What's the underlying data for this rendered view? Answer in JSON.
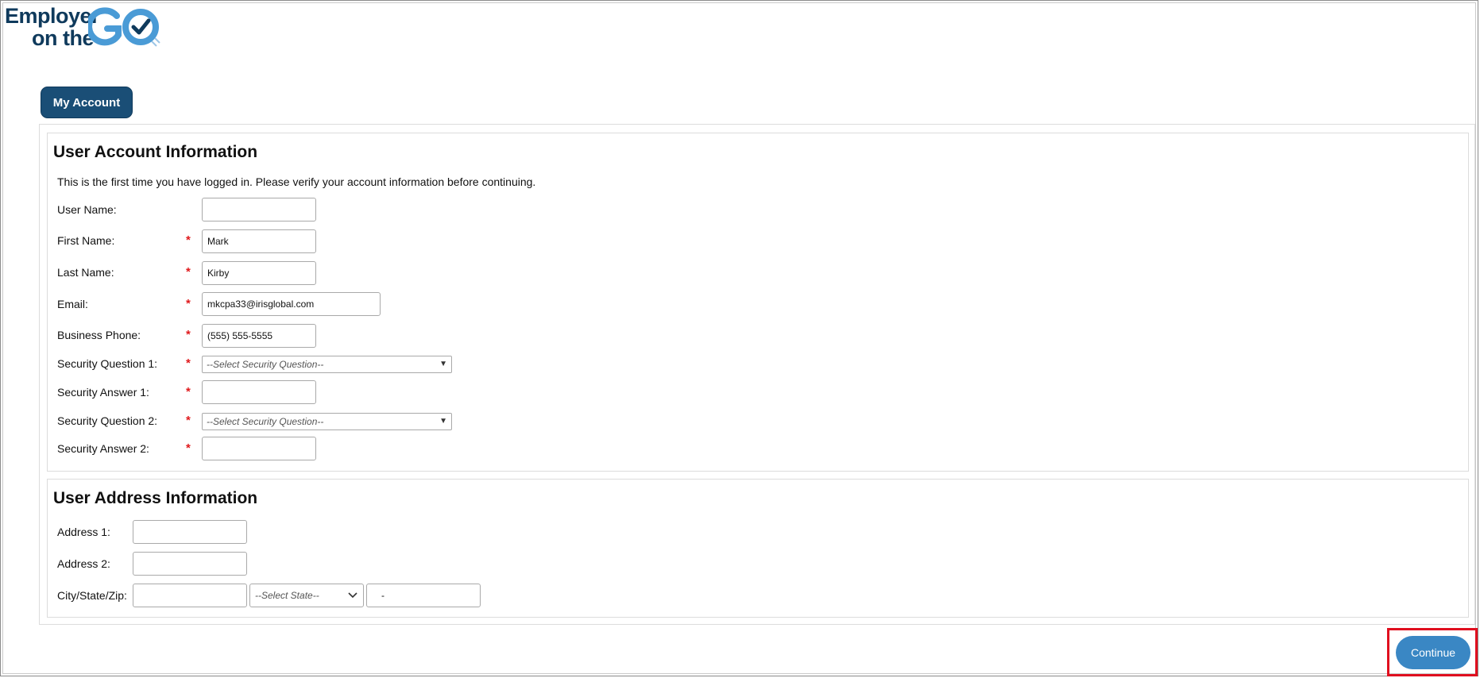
{
  "logo": {
    "line1": "Employer",
    "line2": "on the",
    "mark": "GO"
  },
  "tabs": [
    {
      "label": "My Account"
    }
  ],
  "account": {
    "title": "User Account Information",
    "notice": "This is the first time you have logged in. Please verify your account information before continuing.",
    "required_mark": "*",
    "fields": {
      "username": {
        "label": "User Name:",
        "value": ""
      },
      "first_name": {
        "label": "First Name:",
        "value": "Mark"
      },
      "last_name": {
        "label": "Last Name:",
        "value": "Kirby"
      },
      "email": {
        "label": "Email:",
        "value": "mkcpa33@irisglobal.com"
      },
      "phone": {
        "label": "Business Phone:",
        "value": "(555) 555-5555"
      },
      "q1": {
        "label": "Security Question 1:",
        "value": "--Select Security Question--"
      },
      "a1": {
        "label": "Security Answer 1:",
        "value": ""
      },
      "q2": {
        "label": "Security Question 2:",
        "value": "--Select Security Question--"
      },
      "a2": {
        "label": "Security Answer 2:",
        "value": ""
      }
    }
  },
  "address": {
    "title": "User Address Information",
    "fields": {
      "address1": {
        "label": "Address 1:",
        "value": ""
      },
      "address2": {
        "label": "Address 2:",
        "value": ""
      },
      "city_state_zip": {
        "label": "City/State/Zip:",
        "city": "",
        "state": "--Select State--",
        "zip": "-"
      }
    }
  },
  "actions": {
    "continue": "Continue"
  },
  "colors": {
    "brand": "#1a4e76",
    "accent": "#3a87c4",
    "required": "#e0191c",
    "highlight": "#e00f1f"
  }
}
